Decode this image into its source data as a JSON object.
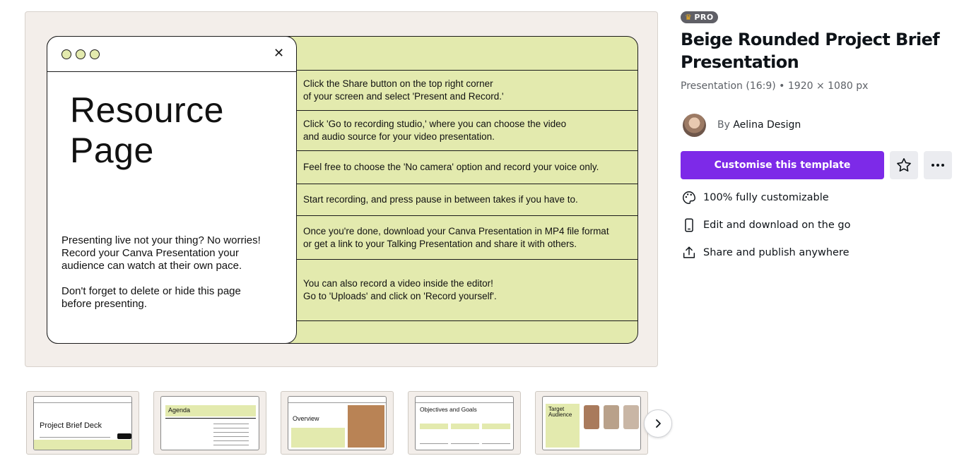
{
  "preview": {
    "slide": {
      "title": "Resource\nPage",
      "body": "Presenting live not your thing? No worries!\nRecord your Canva Presentation your\naudience can watch at their own pace.\n\nDon't forget to delete or hide this page\nbefore presenting.",
      "close_glyph": "✕",
      "rows": [
        "Click the Share button on the top right corner\nof your screen and select 'Present and Record.'",
        "Click 'Go to recording studio,' where you can choose the video\nand audio source for your video presentation.",
        "Feel free to choose the 'No camera' option and record your voice only.",
        "Start recording, and press pause in between takes if you have to.",
        "Once you're done, download your Canva Presentation in MP4 file format\nor get a link to your Talking Presentation and share it with others.",
        "You can also record a video inside the editor!\nGo to 'Uploads' and click on 'Record yourself'."
      ]
    }
  },
  "info": {
    "badge": "PRO",
    "title": "Beige Rounded Project Brief Presentation",
    "meta": "Presentation (16:9) • 1920 × 1080 px",
    "author_prefix": "By",
    "author_name": "Aelina Design",
    "cta": "Customise this template",
    "features": [
      {
        "icon": "palette-icon",
        "label": "100% fully customizable"
      },
      {
        "icon": "phone-icon",
        "label": "Edit and download on the go"
      },
      {
        "icon": "share-icon",
        "label": "Share and publish anywhere"
      }
    ]
  },
  "thumbnails": [
    {
      "title": "Project Brief Deck"
    },
    {
      "title": "Agenda"
    },
    {
      "title": "Overview"
    },
    {
      "title": "Objectives and Goals"
    },
    {
      "title": "Target Audience"
    }
  ],
  "colors": {
    "accent": "#7d2ae8",
    "slide_green": "#e3eaae",
    "slide_beige": "#f3eeea"
  }
}
